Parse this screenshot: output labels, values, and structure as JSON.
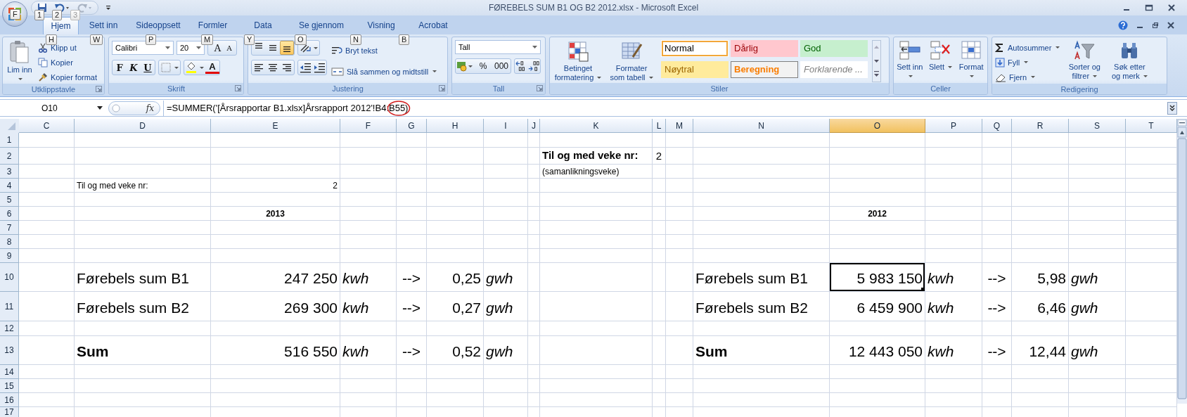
{
  "title_bar": {
    "office_keytip": "F",
    "quick_access": [
      {
        "kind": "save",
        "keytip": "1",
        "disabled": false
      },
      {
        "kind": "undo",
        "keytip": "2",
        "disabled": false
      },
      {
        "kind": "redo",
        "keytip": "3",
        "disabled": true
      }
    ],
    "title": "FØREBELS SUM B1 OG B2 2012.xlsx - Microsoft Excel"
  },
  "tabs": [
    {
      "label": "Hjem",
      "keytip": "H",
      "selected": true
    },
    {
      "label": "Sett inn",
      "keytip": "W",
      "selected": false
    },
    {
      "label": "Sideoppsett",
      "keytip": "P",
      "selected": false
    },
    {
      "label": "Formler",
      "keytip": "M",
      "selected": false
    },
    {
      "label": "Data",
      "keytip": "Y",
      "selected": false
    },
    {
      "label": "Se gjennom",
      "keytip": "O",
      "selected": false
    },
    {
      "label": "Visning",
      "keytip": "N",
      "selected": false
    },
    {
      "label": "Acrobat",
      "keytip": "B",
      "selected": false
    }
  ],
  "ribbon": {
    "clipboard": {
      "label": "Utklippstavle",
      "paste": "Lim inn",
      "items": [
        {
          "kind": "cut",
          "label": "Klipp ut"
        },
        {
          "kind": "copy",
          "label": "Kopier"
        },
        {
          "kind": "painter",
          "label": "Kopier format"
        }
      ]
    },
    "font": {
      "label": "Skrift",
      "font_name": "Calibri",
      "font_size": "20",
      "size_buttons": [
        {
          "kind": "grow",
          "glyph": "A"
        },
        {
          "kind": "shrink",
          "glyph": "A"
        }
      ],
      "style_buttons": [
        {
          "kind": "bold",
          "glyph": "F"
        },
        {
          "kind": "italic",
          "glyph": "K"
        },
        {
          "kind": "underline",
          "glyph": "U"
        }
      ],
      "font_color_glyph": "A"
    },
    "alignment": {
      "label": "Justering",
      "vertical": [
        {
          "kind": "top",
          "selected": false
        },
        {
          "kind": "middle",
          "selected": false
        },
        {
          "kind": "bottom",
          "selected": true
        }
      ],
      "horizontal": [
        {
          "kind": "left",
          "selected": false
        },
        {
          "kind": "center",
          "selected": false
        },
        {
          "kind": "right",
          "selected": false
        }
      ],
      "wrap": "Bryt tekst",
      "merge": "Slå sammen og midtstill"
    },
    "number": {
      "label": "Tall",
      "format": "Tall",
      "buttons": [
        "%",
        "000"
      ]
    },
    "styles": {
      "label": "Stiler",
      "conditional": "Betinget formatering",
      "as_table": "Formater som tabell",
      "gallery": [
        {
          "label": "Normal",
          "kind": "normal",
          "color": "#ffffff",
          "selected": true
        },
        {
          "label": "Dårlig",
          "kind": "bad",
          "color": "#ffc7ce",
          "selected": false
        },
        {
          "label": "God",
          "kind": "good",
          "color": "#c6efce",
          "selected": false
        },
        {
          "label": "Nøytral",
          "kind": "neutral",
          "color": "#ffeb9c",
          "selected": false
        },
        {
          "label": "Beregning",
          "kind": "calculation",
          "color": "#f2f2f2",
          "selected": false
        },
        {
          "label": "Forklarende ...",
          "kind": "explanatory",
          "color": "#ffffff",
          "selected": false
        }
      ]
    },
    "cells": {
      "label": "Celler",
      "buttons": [
        {
          "kind": "insert",
          "label": "Sett inn"
        },
        {
          "kind": "delete",
          "label": "Slett"
        },
        {
          "kind": "format",
          "label": "Format"
        }
      ]
    },
    "editing": {
      "label": "Redigering",
      "items": [
        {
          "kind": "autosum",
          "label": "Autosummer"
        },
        {
          "kind": "fill",
          "label": "Fyll"
        },
        {
          "kind": "clear",
          "label": "Fjern"
        }
      ],
      "big": [
        {
          "kind": "sort",
          "label": "Sorter og filtrer"
        },
        {
          "kind": "find",
          "label": "Søk etter og merk"
        }
      ]
    }
  },
  "formula_bar": {
    "name_box": "O10",
    "function_label": "fx",
    "formula": "=SUMMER('[Årsrapportar B1.xlsx]Årsrapport 2012'!B4:B55)"
  },
  "sheet": {
    "columns": [
      {
        "label": "C",
        "selected": false
      },
      {
        "label": "D",
        "selected": false
      },
      {
        "label": "E",
        "selected": false
      },
      {
        "label": "F",
        "selected": false
      },
      {
        "label": "G",
        "selected": false
      },
      {
        "label": "H",
        "selected": false
      },
      {
        "label": "I",
        "selected": false
      },
      {
        "label": "J",
        "selected": false
      },
      {
        "label": "K",
        "selected": false
      },
      {
        "label": "L",
        "selected": false
      },
      {
        "label": "M",
        "selected": false
      },
      {
        "label": "N",
        "selected": false
      },
      {
        "label": "O",
        "selected": true
      },
      {
        "label": "P",
        "selected": false
      },
      {
        "label": "Q",
        "selected": false
      },
      {
        "label": "R",
        "selected": false
      },
      {
        "label": "S",
        "selected": false
      },
      {
        "label": "T",
        "selected": false
      }
    ],
    "rows": [
      {
        "number": "1",
        "cells": [
          null,
          null,
          null,
          null,
          null,
          null,
          null,
          null,
          null,
          null,
          null,
          null,
          null,
          null,
          null,
          null,
          null,
          null
        ]
      },
      {
        "number": "2",
        "cells": [
          null,
          null,
          null,
          null,
          null,
          null,
          null,
          null,
          {
            "text": "Til og med veke nr:",
            "kind": "title",
            "selected": false
          },
          {
            "text": "2",
            "kind": "title-number",
            "selected": false
          },
          null,
          null,
          null,
          null,
          null,
          null,
          null,
          null
        ]
      },
      {
        "number": "3",
        "cells": [
          null,
          null,
          null,
          null,
          null,
          null,
          null,
          null,
          {
            "text": "(samanlikningsveke)",
            "kind": "note",
            "selected": false
          },
          null,
          null,
          null,
          null,
          null,
          null,
          null,
          null,
          null
        ]
      },
      {
        "number": "4",
        "cells": [
          null,
          {
            "text": "Til og med veke nr:",
            "kind": "note",
            "selected": false
          },
          {
            "text": "2",
            "kind": "note-number",
            "selected": false
          },
          null,
          null,
          null,
          null,
          null,
          null,
          null,
          null,
          null,
          null,
          null,
          null,
          null,
          null,
          null
        ]
      },
      {
        "number": "5",
        "cells": [
          null,
          null,
          null,
          null,
          null,
          null,
          null,
          null,
          null,
          null,
          null,
          null,
          null,
          null,
          null,
          null,
          null,
          null
        ]
      },
      {
        "number": "6",
        "cells": [
          null,
          null,
          {
            "text": "2013",
            "kind": "heading",
            "selected": false
          },
          null,
          null,
          null,
          null,
          null,
          null,
          null,
          null,
          null,
          {
            "text": "2012",
            "kind": "heading",
            "selected": false
          },
          null,
          null,
          null,
          null,
          null
        ]
      },
      {
        "number": "7",
        "cells": [
          null,
          null,
          null,
          null,
          null,
          null,
          null,
          null,
          null,
          null,
          null,
          null,
          null,
          null,
          null,
          null,
          null,
          null
        ]
      },
      {
        "number": "8",
        "cells": [
          null,
          null,
          null,
          null,
          null,
          null,
          null,
          null,
          null,
          null,
          null,
          null,
          null,
          null,
          null,
          null,
          null,
          null
        ]
      },
      {
        "number": "9",
        "cells": [
          null,
          null,
          null,
          null,
          null,
          null,
          null,
          null,
          null,
          null,
          null,
          null,
          null,
          null,
          null,
          null,
          null,
          null
        ]
      },
      {
        "number": "10",
        "cells": [
          null,
          {
            "text": "Førebels sum B1",
            "kind": "big-label",
            "selected": false
          },
          {
            "text": "247 250",
            "kind": "big-number",
            "selected": false
          },
          {
            "text": "kwh",
            "kind": "big-unit",
            "selected": false
          },
          {
            "text": "-->",
            "kind": "big-arrow",
            "selected": false
          },
          {
            "text": "0,25",
            "kind": "big-number",
            "selected": false
          },
          {
            "text": "gwh",
            "kind": "big-unit",
            "selected": false
          },
          null,
          null,
          null,
          null,
          {
            "text": "Førebels sum B1",
            "kind": "big-label",
            "selected": false
          },
          {
            "text": "5 983 150",
            "kind": "big-number",
            "selected": true
          },
          {
            "text": "kwh",
            "kind": "big-unit",
            "selected": false
          },
          {
            "text": "-->",
            "kind": "big-arrow",
            "selected": false
          },
          {
            "text": "5,98",
            "kind": "big-number",
            "selected": false
          },
          {
            "text": "gwh",
            "kind": "big-unit",
            "selected": false
          },
          null
        ]
      },
      {
        "number": "11",
        "cells": [
          null,
          {
            "text": "Førebels sum B2",
            "kind": "big-label",
            "selected": false
          },
          {
            "text": "269 300",
            "kind": "big-number",
            "selected": false
          },
          {
            "text": "kwh",
            "kind": "big-unit",
            "selected": false
          },
          {
            "text": "-->",
            "kind": "big-arrow",
            "selected": false
          },
          {
            "text": "0,27",
            "kind": "big-number",
            "selected": false
          },
          {
            "text": "gwh",
            "kind": "big-unit",
            "selected": false
          },
          null,
          null,
          null,
          null,
          {
            "text": "Førebels sum B2",
            "kind": "big-label",
            "selected": false
          },
          {
            "text": "6 459 900",
            "kind": "big-number",
            "selected": false
          },
          {
            "text": "kwh",
            "kind": "big-unit",
            "selected": false
          },
          {
            "text": "-->",
            "kind": "big-arrow",
            "selected": false
          },
          {
            "text": "6,46",
            "kind": "big-number",
            "selected": false
          },
          {
            "text": "gwh",
            "kind": "big-unit",
            "selected": false
          },
          null
        ]
      },
      {
        "number": "12",
        "cells": [
          null,
          null,
          null,
          null,
          null,
          null,
          null,
          null,
          null,
          null,
          null,
          null,
          null,
          null,
          null,
          null,
          null,
          null
        ]
      },
      {
        "number": "13",
        "cells": [
          null,
          {
            "text": "Sum",
            "kind": "big-total",
            "selected": false
          },
          {
            "text": "516 550",
            "kind": "big-number",
            "selected": false
          },
          {
            "text": "kwh",
            "kind": "big-unit",
            "selected": false
          },
          {
            "text": "-->",
            "kind": "big-arrow",
            "selected": false
          },
          {
            "text": "0,52",
            "kind": "big-number",
            "selected": false
          },
          {
            "text": "gwh",
            "kind": "big-unit",
            "selected": false
          },
          null,
          null,
          null,
          null,
          {
            "text": "Sum",
            "kind": "big-total",
            "selected": false
          },
          {
            "text": "12 443 050",
            "kind": "big-number",
            "selected": false
          },
          {
            "text": "kwh",
            "kind": "big-unit",
            "selected": false
          },
          {
            "text": "-->",
            "kind": "big-arrow",
            "selected": false
          },
          {
            "text": "12,44",
            "kind": "big-number",
            "selected": false
          },
          {
            "text": "gwh",
            "kind": "big-unit",
            "selected": false
          },
          null
        ]
      },
      {
        "number": "14",
        "cells": [
          null,
          null,
          null,
          null,
          null,
          null,
          null,
          null,
          null,
          null,
          null,
          null,
          null,
          null,
          null,
          null,
          null,
          null
        ]
      },
      {
        "number": "15",
        "cells": [
          null,
          null,
          null,
          null,
          null,
          null,
          null,
          null,
          null,
          null,
          null,
          null,
          null,
          null,
          null,
          null,
          null,
          null
        ]
      },
      {
        "number": "16",
        "cells": [
          null,
          null,
          null,
          null,
          null,
          null,
          null,
          null,
          null,
          null,
          null,
          null,
          null,
          null,
          null,
          null,
          null,
          null
        ]
      },
      {
        "number": "17",
        "cells": [
          null,
          null,
          null,
          null,
          null,
          null,
          null,
          null,
          null,
          null,
          null,
          null,
          null,
          null,
          null,
          null,
          null,
          null
        ]
      }
    ]
  }
}
